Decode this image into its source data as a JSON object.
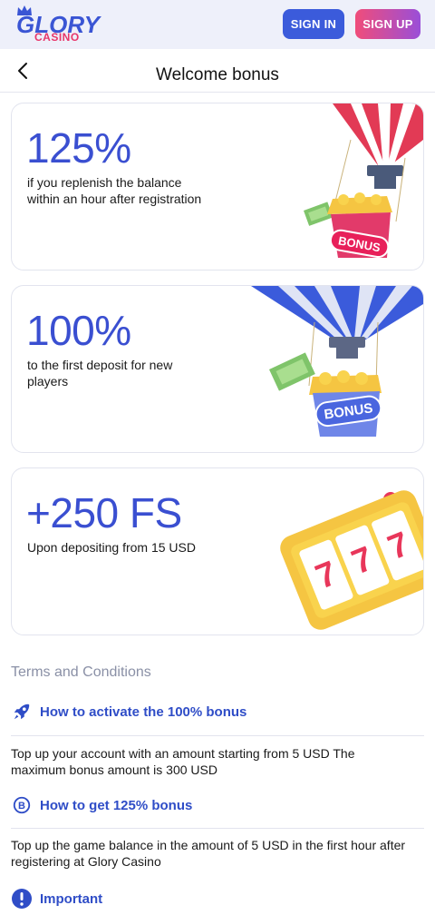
{
  "brand": {
    "name": "GLORY",
    "sub": "CASINO"
  },
  "nav": {
    "signin": "SIGN IN",
    "signup": "SIGN UP"
  },
  "page": {
    "title": "Welcome bonus"
  },
  "cards": [
    {
      "big": "125%",
      "desc": "if you replenish the balance within an hour after registration",
      "badge": "BONUS"
    },
    {
      "big": "100%",
      "desc": "to the first deposit for new players",
      "badge": "BONUS"
    },
    {
      "big": "+250 FS",
      "desc": "Upon depositing from 15 USD"
    }
  ],
  "terms": {
    "title": "Terms and Conditions",
    "items": [
      {
        "icon": "rocket-icon",
        "q": "How to activate the 100% bonus",
        "a": "Top up your account with an amount starting from 5 USD The maximum bonus amount is 300 USD"
      },
      {
        "icon": "bitcoin-icon",
        "q": "How to get 125% bonus",
        "a": "Top up the game balance in the amount of 5 USD in the first hour after registering at Glory Casino"
      },
      {
        "icon": "exclamation-icon",
        "q": "Important"
      }
    ]
  },
  "colors": {
    "accent": "#3a4fd1",
    "signup_start": "#f04d7a",
    "signup_end": "#9a4ed8",
    "signin": "#3b5bdb"
  }
}
